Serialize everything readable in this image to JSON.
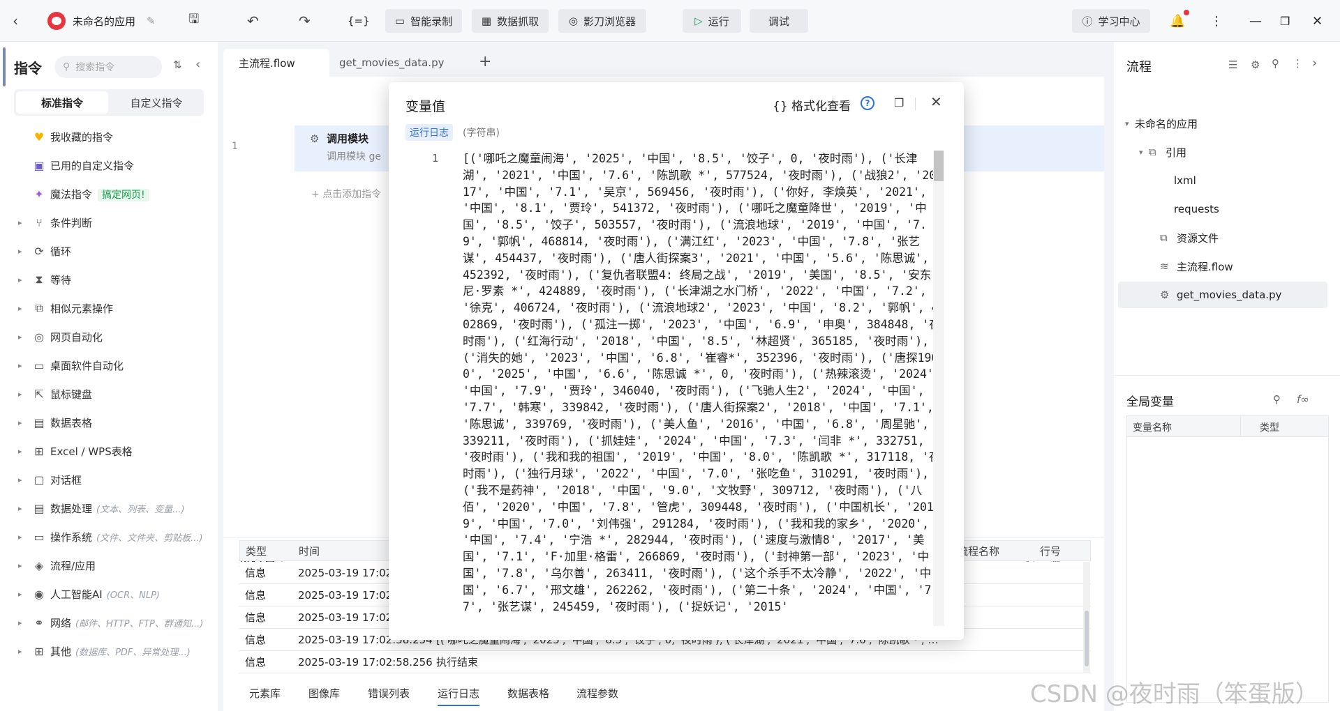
{
  "app": {
    "title": "未命名的应用"
  },
  "toolbar": {
    "smart_record": "智能录制",
    "data_capture": "数据抓取",
    "browser": "影刀浏览器",
    "run": "运行",
    "debug": "调试",
    "learn": "学习中心"
  },
  "left": {
    "title": "指令",
    "search_placeholder": "搜索指令",
    "tab_standard": "标准指令",
    "tab_custom": "自定义指令",
    "fav": "我收藏的指令",
    "used_custom": "已用的自定义指令",
    "magic": "魔法指令",
    "magic_badge": "搞定网页!",
    "items": [
      {
        "label": "条件判断",
        "sub": ""
      },
      {
        "label": "循环",
        "sub": ""
      },
      {
        "label": "等待",
        "sub": ""
      },
      {
        "label": "相似元素操作",
        "sub": ""
      },
      {
        "label": "网页自动化",
        "sub": ""
      },
      {
        "label": "桌面软件自动化",
        "sub": ""
      },
      {
        "label": "鼠标键盘",
        "sub": ""
      },
      {
        "label": "数据表格",
        "sub": ""
      },
      {
        "label": "Excel / WPS表格",
        "sub": ""
      },
      {
        "label": "对话框",
        "sub": ""
      },
      {
        "label": "数据处理",
        "sub": "(文本、列表、变量...)"
      },
      {
        "label": "操作系统",
        "sub": "(文件、文件夹、剪贴板...)"
      },
      {
        "label": "流程/应用",
        "sub": ""
      },
      {
        "label": "人工智能AI",
        "sub": "(OCR、NLP)"
      },
      {
        "label": "网络",
        "sub": "(邮件、HTTP、FTP、群通知...)"
      },
      {
        "label": "其他",
        "sub": "(数据库、PDF、异常处理...)"
      }
    ]
  },
  "editor": {
    "tabs": [
      "主流程.flow",
      "get_movies_data.py"
    ],
    "line_no": "1",
    "step_title": "调用模块",
    "step_desc": "调用模块 ge",
    "add_hint": "点击添加指令"
  },
  "log": {
    "title": "运行日志",
    "headers": [
      "类型",
      "时间",
      "流程名称",
      "行号"
    ],
    "rows": [
      {
        "type": "信息",
        "time": "2025-03-19 17:02:",
        "content": ""
      },
      {
        "type": "信息",
        "time": "2025-03-19 17:02:",
        "content": ""
      },
      {
        "type": "信息",
        "time": "2025-03-19 17:02:",
        "content": ""
      },
      {
        "type": "信息",
        "time": "2025-03-19 17:02:58.254",
        "content": "[('哪吒之魔童闹海', '2025', '中国', '8.5', '饺子', 0, '夜时雨'), ('长津湖', '2021', '中国', '7.6', '陈凯歌 *', 5775..."
      },
      {
        "type": "信息",
        "time": "2025-03-19 17:02:58.256",
        "content": "执行结束"
      }
    ],
    "bottom_tabs": [
      "元素库",
      "图像库",
      "错误列表",
      "运行日志",
      "数据表格",
      "流程参数"
    ]
  },
  "right": {
    "title": "流程",
    "tree": [
      "未命名的应用",
      "引用",
      "lxml",
      "requests",
      "资源文件",
      "主流程.flow",
      "get_movies_data.py"
    ],
    "globals_title": "全局变量",
    "globals_headers": [
      "变量名称",
      "类型"
    ]
  },
  "modal": {
    "title": "变量值",
    "format_view": "{} 格式化查看",
    "tag": "运行日志",
    "type": "(字符串)",
    "line_no": "1",
    "value": "[('哪吒之魔童闹海', '2025', '中国', '8.5', '饺子', 0, '夜时雨'), ('长津湖', '2021', '中国', '7.6', '陈凯歌 *', 577524, '夜时雨'), ('战狼2', '2017', '中国', '7.1', '吴京', 569456, '夜时雨'), ('你好, 李焕英', '2021', '中国', '8.1', '贾玲', 541372, '夜时雨'), ('哪吒之魔童降世', '2019', '中国', '8.5', '饺子', 503557, '夜时雨'), ('流浪地球', '2019', '中国', '7.9', '郭帆', 468814, '夜时雨'), ('满江红', '2023', '中国', '7.8', '张艺谋', 454437, '夜时雨'), ('唐人街探案3', '2021', '中国', '5.6', '陈思诚', 452392, '夜时雨'), ('复仇者联盟4: 终局之战', '2019', '美国', '8.5', '安东尼·罗素 *', 424889, '夜时雨'), ('长津湖之水门桥', '2022', '中国', '7.2', '徐克', 406724, '夜时雨'), ('流浪地球2', '2023', '中国', '8.2', '郭帆', 402869, '夜时雨'), ('孤注一掷', '2023', '中国', '6.9', '申奥', 384848, '夜时雨'), ('红海行动', '2018', '中国', '8.5', '林超贤', 365185, '夜时雨'), ('消失的她', '2023', '中国', '6.8', '崔睿*', 352396, '夜时雨'), ('唐探1900', '2025', '中国', '6.6', '陈思诚 *', 0, '夜时雨'), ('热辣滚烫', '2024', '中国', '7.9', '贾玲', 346040, '夜时雨'), ('飞驰人生2', '2024', '中国', '7.7', '韩寒', 339842, '夜时雨'), ('唐人街探案2', '2018', '中国', '7.1', '陈思诚', 339769, '夜时雨'), ('美人鱼', '2016', '中国', '6.8', '周星驰', 339211, '夜时雨'), ('抓娃娃', '2024', '中国', '7.3', '闫非 *', 332751, '夜时雨'), ('我和我的祖国', '2019', '中国', '8.0', '陈凯歌 *', 317118, '夜时雨'), ('独行月球', '2022', '中国', '7.0', '张吃鱼', 310291, '夜时雨'), ('我不是药神', '2018', '中国', '9.0', '文牧野', 309712, '夜时雨'), ('八佰', '2020', '中国', '7.8', '管虎', 309448, '夜时雨'), ('中国机长', '2019', '中国', '7.0', '刘伟强', 291284, '夜时雨'), ('我和我的家乡', '2020', '中国', '7.4', '宁浩 *', 282944, '夜时雨'), ('速度与激情8', '2017', '美国', '7.1', 'F·加里·格雷', 266869, '夜时雨'), ('封神第一部', '2023', '中国', '7.8', '乌尔善', 263411, '夜时雨'), ('这个杀手不太冷静', '2022', '中国', '6.7', '邢文雄', 262262, '夜时雨'), ('第二十条', '2024', '中国', '7.7', '张艺谋', 245459, '夜时雨'), ('捉妖记', '2015'"
  },
  "watermark": "CSDN @夜时雨（笨蛋版）"
}
